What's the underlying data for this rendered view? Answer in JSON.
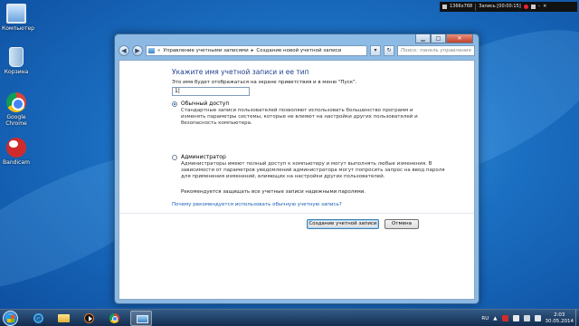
{
  "desktop": {
    "icons": [
      {
        "label": "Компьютер"
      },
      {
        "label": "Корзина"
      },
      {
        "label": "Google Chrome"
      },
      {
        "label": "Bandicam"
      }
    ]
  },
  "recording_bar": {
    "resolution": "1366x768",
    "status": "Запись [00:00:15]"
  },
  "window": {
    "breadcrumb": [
      "Управление учетными записями",
      "Создание новой учетной записи"
    ],
    "search_placeholder": "Поиск: панель управления",
    "heading": "Укажите имя учетной записи и ее тип",
    "description": "Это имя будет отображаться на экране приветствия и в меню \"Пуск\".",
    "name_value": "1|",
    "options": [
      {
        "title": "Обычный доступ",
        "selected": true,
        "desc": [
          "Стандартные записи пользователей позволяют использовать большинство программ и",
          "изменять параметры системы, которые не влияют на настройки других пользователей и",
          "безопасность компьютера."
        ]
      },
      {
        "title": "Администратор",
        "selected": false,
        "desc": [
          "Администраторы имеют полный доступ к компьютеру и могут выполнять любые изменения. В",
          "зависимости от параметров уведомлений администратора могут попросить запрос на ввод пароля",
          "для применения изменений, влияющих на настройки других пользователей."
        ]
      }
    ],
    "recommendation": "Рекомендуется защищать все учетные записи надежными паролями.",
    "help_link": "Почему рекомендуется использовать обычную учетную запись?",
    "create_button": "Создание учетной записи",
    "cancel_button": "Отмена"
  },
  "taskbar": {
    "language": "RU",
    "time": "2:03",
    "date": "30.05.2014"
  }
}
